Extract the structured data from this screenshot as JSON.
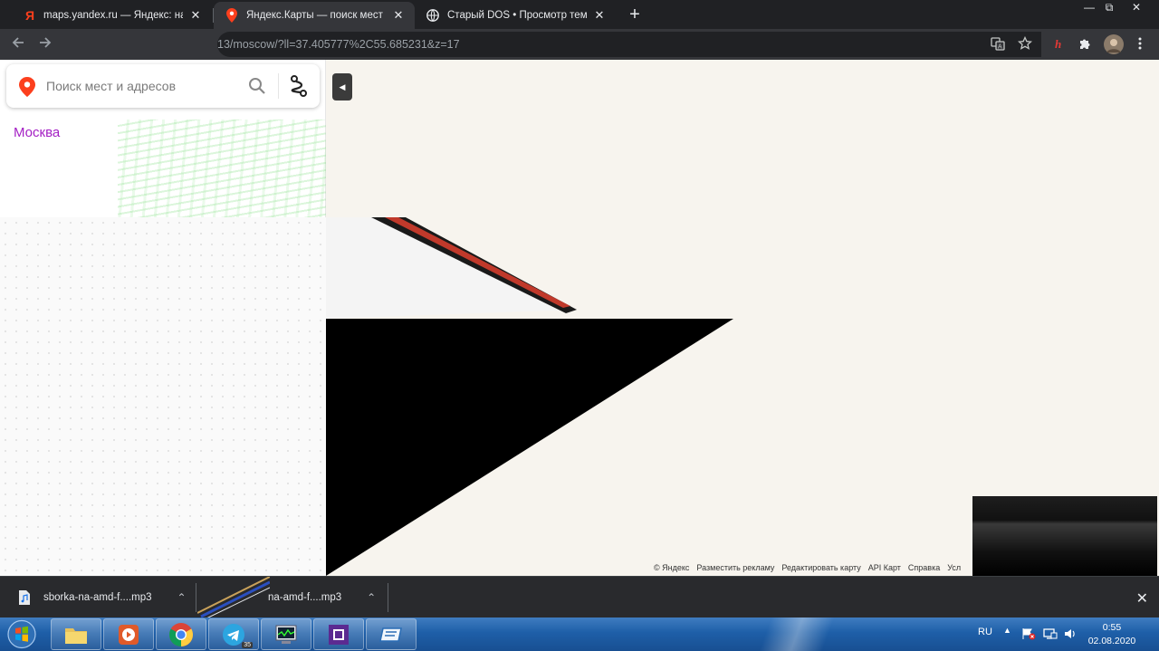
{
  "tabs": [
    {
      "title": "maps.yandex.ru — Яндекс: нашл",
      "icon": "yandex-logo-icon",
      "active": false
    },
    {
      "title": "Яндекс.Карты — поиск мест и а",
      "icon": "maps-pin-icon",
      "active": true
    },
    {
      "title": "Старый DOS • Просмотр темы -",
      "icon": "globe-icon",
      "active": false
    }
  ],
  "tab_close_glyph": "✕",
  "new_tab_glyph": "+",
  "window_controls": {
    "minimize": "—",
    "restore": "⧉",
    "close": "✕"
  },
  "toolbar": {
    "url": "13/moscow/?ll=37.405777%2C55.685231&z=17"
  },
  "map": {
    "search_placeholder": "Поиск мест и адресов",
    "city": "Москва",
    "collapse_glyph": "◀",
    "footer_links": [
      "© Яндекс",
      "Разместить рекламу",
      "Редактировать карту",
      "API Карт",
      "Справка",
      "Усл"
    ]
  },
  "downloads": {
    "items": [
      {
        "name": "sborka-na-amd-f....mp3"
      },
      {
        "name": "na-amd-f....mp3"
      }
    ],
    "chevron": "⌃",
    "close": "✕"
  },
  "taskbar": {
    "language": "RU",
    "time": "0:55",
    "date": "02.08.2020",
    "telegram_badge": "35",
    "apps": [
      "explorer-icon",
      "media-player-icon",
      "chrome-icon",
      "telegram-icon",
      "task-manager-icon",
      "cpu-z-icon",
      "storage-icon"
    ]
  },
  "colors": {
    "chrome_dark": "#202124",
    "chrome_toolbar": "#35363a",
    "map_background": "#f7f4ee",
    "city_link": "#a420c4",
    "yandex_red": "#fc3f1d",
    "taskbar_blue": "#1e5fa8"
  }
}
